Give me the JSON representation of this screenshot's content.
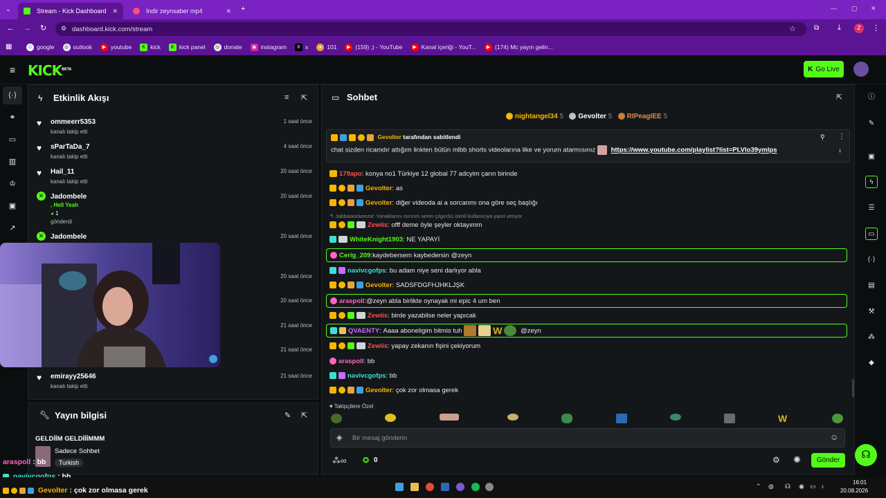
{
  "browser": {
    "tabs": [
      {
        "title": "Stream - Kick Dashboard",
        "active": true
      },
      {
        "title": "İndir zeynsaber mp4",
        "active": false
      }
    ],
    "url": "dashboard.kick.com/stream",
    "profile_letter": "Z",
    "bookmarks": [
      "google",
      "outlook",
      "youtube",
      "kick",
      "kick panel",
      "donate",
      "instagram",
      "x",
      "101",
      "(159) ;) - YouTube",
      "Kanal içeriği - YouT...",
      "(174) Mc yayın gelin..."
    ]
  },
  "header": {
    "logo": "KICK",
    "logo_suffix": "BETA",
    "go_live": "Go Live"
  },
  "activity": {
    "title": "Etkinlik Akışı",
    "items": [
      {
        "user": "ommeerr5353",
        "text": "kanalı takip etti",
        "time": "1 saat önce"
      },
      {
        "user": "sParTaDa_7",
        "text": "kanalı takip etti",
        "time": "4 saat önce"
      },
      {
        "user": "Hail_11",
        "text": "kanalı takip etti",
        "time": "20 saat önce"
      },
      {
        "user": "Jadombele",
        "text": ", Hell Yeah",
        "amount": "1",
        "text2": "gönderdi",
        "time": "20 saat önce"
      },
      {
        "user": "Jadombele",
        "text": "",
        "time": "20 saat önce"
      },
      {
        "user": "",
        "text": "",
        "time": "20 saat önce"
      },
      {
        "user": "",
        "text": "",
        "time": "20 saat önce"
      },
      {
        "user": "",
        "text": "",
        "time": "21 saat önce"
      },
      {
        "user": "",
        "text": "",
        "time": "21 saat önce"
      },
      {
        "user": "emirayy25646",
        "text": "kanalı takip etti",
        "time": "21 saat önce"
      }
    ]
  },
  "stream_info": {
    "title": "Yayın bilgisi",
    "stream_title": "GELDİİM GELDİİİMMM",
    "category": "Sadece Sohbet",
    "language": "Turkish"
  },
  "overlay_chat": [
    {
      "user": "araspoll",
      "sep": ":",
      "msg": "bb"
    },
    {
      "user": "navivcgofps",
      "sep": ":",
      "msg": "bb"
    },
    {
      "user": "Gevolter",
      "sep": ":",
      "msg": "çok zor olmasa gerek"
    }
  ],
  "chat": {
    "title": "Sohbet",
    "leaderboard": [
      {
        "rank": "1",
        "name": "nightangel34",
        "count": "5"
      },
      {
        "rank": "2",
        "name": "Gevolter",
        "count": "5"
      },
      {
        "rank": "3",
        "name": "RIPeagIEE",
        "count": "5"
      }
    ],
    "pinned": {
      "by_user": "Gevolter",
      "by_suffix": "tarafından sabitlendi",
      "text": "chat sizden ricamdır attığım linkten bütün mlbb shorts videolarına like ve yorum atarmısınız",
      "link": "https://www.youtube.com/playlist?list=PLVIo39ymlps"
    },
    "messages": [
      {
        "user": "179apo",
        "color": "#ff4d4d",
        "msg": "konya no1 Türkiye 12 global 77 adcyim çarın birinde",
        "hl": false
      },
      {
        "user": "Gevolter",
        "color": "#f7b600",
        "msg": "as",
        "hl": false
      },
      {
        "user": "Gevolter",
        "color": "#f7b600",
        "msg": "diğer videoda ai a sorcanmı ona göre seç başlığı",
        "hl": false
      },
      {
        "reply": "Jabbawockeezvl: Yanaklarını ısırırım senin çılgınSs isimli kullanıcıya yanıt veriyor",
        "user": "Zewiis",
        "color": "#ff4d4d",
        "msg": "offf deme öyle şeyler oktayımm",
        "hl": false
      },
      {
        "user": "WhiteKnight1903",
        "color": "#53fc18",
        "msg": "NE YAPAYİ",
        "hl": false
      },
      {
        "user": "Cerig_209",
        "color": "#53fc18",
        "msg": "kaydebersem kaybedersin @zeyn",
        "hl": true
      },
      {
        "user": "navivcgofps",
        "color": "#3de0d0",
        "msg": "bu adam niye seni darlıyor abla",
        "hl": false
      },
      {
        "user": "Gevolter",
        "color": "#f7b600",
        "msg": "SADSFDGFHJHKLJŞK",
        "hl": false
      },
      {
        "user": "araspoll",
        "color": "#ff66c4",
        "msg": "@zeyn abla birlikte oynayak mi epic 4 um ben",
        "hl": true
      },
      {
        "user": "Zewiis",
        "color": "#ff4d4d",
        "msg": "birde yazabilse neler yapıcak",
        "hl": false
      },
      {
        "user": "QVAENTY",
        "color": "#c86bff",
        "msg": "Aaaa aboneligim bitmis tuh",
        "tail": "@zeyn",
        "hl": true
      },
      {
        "user": "Zewiis",
        "color": "#ff4d4d",
        "msg": "yapay zekanın fişini çekiyorum",
        "hl": false
      },
      {
        "user": "araspoll",
        "color": "#ff66c4",
        "msg": "bb",
        "hl": false
      },
      {
        "user": "navivcgofps",
        "color": "#3de0d0",
        "msg": "bb",
        "hl": false
      },
      {
        "user": "Gevolter",
        "color": "#f7b600",
        "msg": "çok zor olmasa gerek",
        "hl": false
      }
    ],
    "emote_section": "Takipçilere Özel",
    "input_placeholder": "Bir mesaj gönderin",
    "points": "0",
    "send": "Gönder"
  },
  "taskbar": {
    "time": "16:01",
    "date": "20.08.2026"
  },
  "colors": {
    "accent": "#53fc18",
    "browser": "#7a22c2"
  }
}
